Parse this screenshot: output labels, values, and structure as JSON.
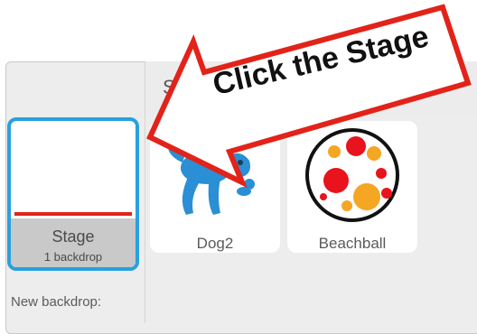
{
  "header": {
    "partial_label": "S"
  },
  "stage": {
    "name": "Stage",
    "backdrop_count": "1 backdrop"
  },
  "new_backdrop_label": "New backdrop:",
  "sprites": [
    {
      "name": "Dog2",
      "icon": "dog-icon"
    },
    {
      "name": "Beachball",
      "icon": "beachball-icon"
    }
  ],
  "callout": {
    "text": "Click the Stage",
    "color": "#e2231a"
  },
  "colors": {
    "selection": "#29a0e0",
    "accent_red": "#e2231a"
  }
}
